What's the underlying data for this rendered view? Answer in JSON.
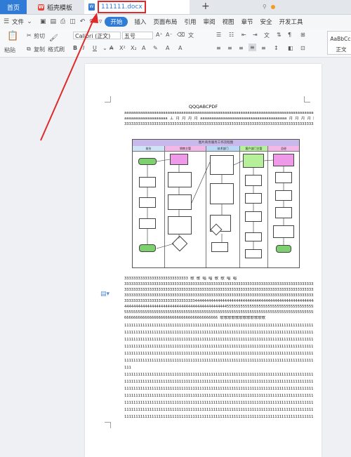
{
  "tabs": {
    "home_label": "首页",
    "wps_label": "稻壳模板",
    "wps_logo": "W",
    "doc_logo": "W",
    "doc_label": "111111.docx",
    "add_label": "+"
  },
  "menu": {
    "file_label": "文件",
    "items": [
      "开始",
      "插入",
      "页面布局",
      "引用",
      "审阅",
      "视图",
      "章节",
      "安全",
      "开发工具"
    ],
    "active_index": 0
  },
  "ribbon": {
    "paste_label": "粘贴",
    "cut_label": "剪切",
    "copy_label": "复制",
    "format_painter_label": "格式刷",
    "font_name": "Calibri (正文)",
    "font_size": "五号",
    "style_preview": "AaBbCcI",
    "style_name": "正文"
  },
  "document": {
    "heading": "QQQABCPDF",
    "lines_top": [
      "aaaaaaaaaaaaaaaaaaaaaaaaaaaaaaaaaaaaaaaaaaaaaaaaaaaaaaaaaaaaaaaaaaaaaaaaaaaaaaaaaaaaaaaaaa",
      "aaaaaaaaaaaaaaaaaaa 工 月 月 月 月 aaaaaaaaaaaaaaaaaaaaaaaaaaaaaaaaaaaaaa 月 月 月 月 阴",
      "333333333333333333333333333333333333333333333333333333333333333333333333333333333333333"
    ],
    "lines_bottom": [
      "3333333333333333333333333333  歌  歌  唱  唱  歌  歌  唱  唱",
      "33333333333333333333333333333333333333333333333333333333333333333333333333333333333333",
      "33333333333333333333333333333333333333333333333333333333333333333333333333333333333333",
      "33333333333333333333333333333333333333333333333333333333333333333333333333333333333333",
      "33333333333333333333333333333334444444444444444444444444444444444444444444444444444444",
      "44444444444444444444444444444444444444444444455555555555555555555555555555555555555555",
      "55555555555555555555555555555555555555555555555555555555555555555555555555555555555555",
      "66666666666666666666666666666666666666666 歌歌歌歌歌歌歌歌歌歌歌歌",
      "11111111111111111111111111111111111111111111111111111111111111111111111111111111111111",
      "11111111111111111111111111111111111111111111111111111111111111111111111111111111111111",
      "11111111111111111111111111111111111111111111111111111111111111111111111111111111111111",
      "11111111111111111111111111111111111111111111111111111111111111111111111111111111111111",
      "11111111111111111111111111111111111111111111111111111111111111111111111111111111111111",
      "11111111111111111111111111111111111111111111111111111111111111111111111111111111111111",
      "111",
      "11111111111111111111111111111111111111111111111111111111111111111111111111111111111111",
      "11111111111111111111111111111111111111111111111111111111111111111111111111111111111111",
      "11111111111111111111111111111111111111111111111111111111111111111111111111111111111111",
      "11111111111111111111111111111111111111111111111111111111111111111111111111111111111111",
      "11111111111111111111111111111111111111111111111111111111111111111111111111111111111111",
      "11111111111111111111111111111111111111111111111111111111111111111111111111111111111111",
      "11111111111111111111111111111111111111111111111111111111111111111111111111111111111111"
    ]
  },
  "flowchart": {
    "title": "图片商务服务工作流程图",
    "lanes": [
      "前台",
      "销售主管",
      "技术部门",
      "客户部门主管",
      "总经"
    ]
  },
  "colors": {
    "accent": "#2f7bd6",
    "highlight_border": "#e02a2a",
    "arrow": "#e02a2a",
    "modified_dot": "#f59a23"
  }
}
